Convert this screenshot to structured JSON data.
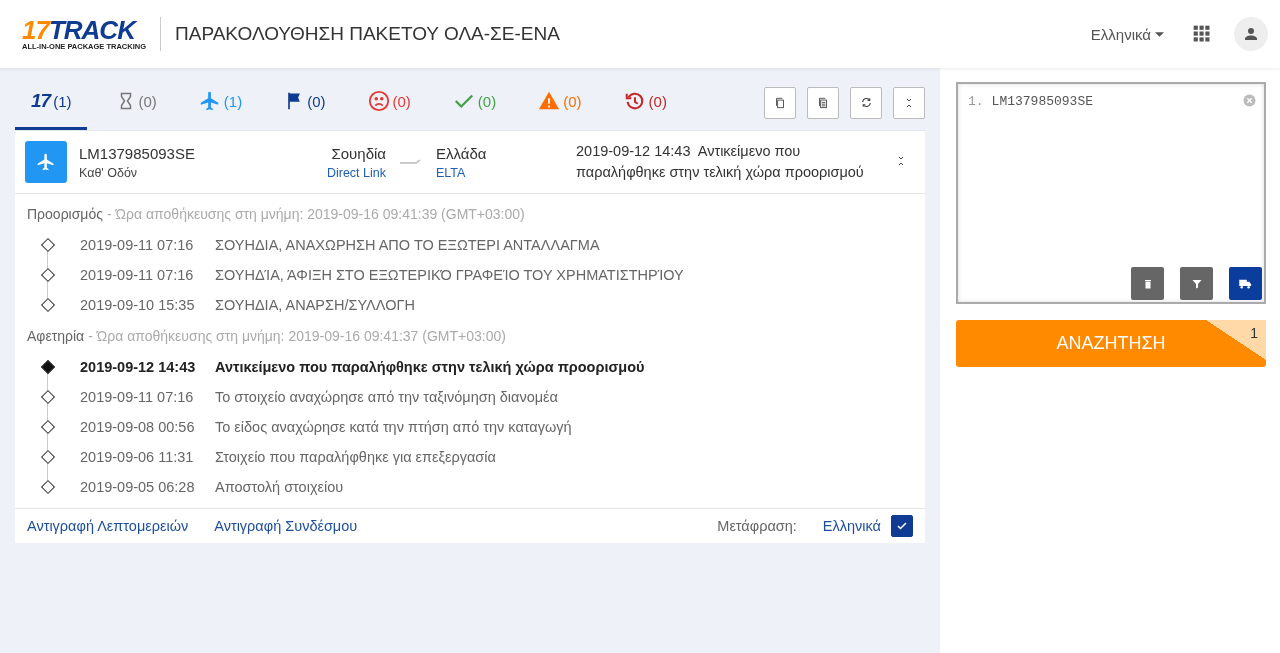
{
  "header": {
    "logo": {
      "number": "17",
      "word": "TRACK",
      "tagline": "ALL-IN-ONE PACKAGE TRACKING"
    },
    "title": "ΠΑΡΑΚΟΛΟΥΘΗΣΗ ΠΑΚΕΤΟΥ ΟΛΑ-ΣΕ-ΕΝΑ",
    "language": "Ελληνικά"
  },
  "tabs": [
    {
      "kind": "all",
      "glyph": "17",
      "count": "(1)",
      "selected": true
    },
    {
      "kind": "pending",
      "count": "(0)",
      "selected": false
    },
    {
      "kind": "transit",
      "count": "(1)",
      "selected": false
    },
    {
      "kind": "pickup",
      "count": "(0)",
      "selected": false
    },
    {
      "kind": "undelivered",
      "count": "(0)",
      "selected": false
    },
    {
      "kind": "delivered",
      "count": "(0)",
      "selected": false
    },
    {
      "kind": "alert",
      "count": "(0)",
      "selected": false
    },
    {
      "kind": "expired",
      "count": "(0)",
      "selected": false
    }
  ],
  "package": {
    "number": "LM137985093SE",
    "status": "Καθ' Οδόν",
    "origin": "Σουηδία",
    "origin_carrier": "Direct Link",
    "destination": "Ελλάδα",
    "destination_carrier": "ELTA",
    "latest_time": "2019-09-12 14:43",
    "latest_event": "Αντικείμενο που παραλήφθηκε στην τελική χώρα προορισμού"
  },
  "sections": [
    {
      "label": "Προορισμός",
      "stored": "- Ώρα αποθήκευσης στη μνήμη: 2019-09-16 09:41:39 (GMT+03:00)",
      "events": [
        {
          "time": "2019-09-11 07:16",
          "text": "ΣΟΥΗΔΙΑ, ΑΝΑΧΩΡΗΣΗ ΑΠΟ ΤΟ ΕΞΩΤΕΡΙ ΑΝΤΑΛΛΑΓΜΑ",
          "latest": false
        },
        {
          "time": "2019-09-11 07:16",
          "text": "ΣΟΥΗΔΊΑ, ΆΦΙΞΗ ΣΤΟ ΕΞΩΤΕΡΙΚΌ ΓΡΑΦΕΊΟ ΤΟΥ ΧΡΗΜΑΤΙΣΤΗΡΊΟΥ",
          "latest": false
        },
        {
          "time": "2019-09-10 15:35",
          "text": "ΣΟΥΗΔΙΑ, ΑΝΑΡΣΗ/ΣΥΛΛΟΓΗ",
          "latest": false
        }
      ]
    },
    {
      "label": "Αφετηρία",
      "stored": "- Ώρα αποθήκευσης στη μνήμη: 2019-09-16 09:41:37 (GMT+03:00)",
      "events": [
        {
          "time": "2019-09-12 14:43",
          "text": "Αντικείμενο που παραλήφθηκε στην τελική χώρα προορισμού",
          "latest": true
        },
        {
          "time": "2019-09-11 07:16",
          "text": "Το στοιχείο αναχώρησε από την ταξινόμηση διανομέα",
          "latest": false
        },
        {
          "time": "2019-09-08 00:56",
          "text": "Το είδος αναχώρησε κατά την πτήση από την καταγωγή",
          "latest": false
        },
        {
          "time": "2019-09-06 11:31",
          "text": "Στοιχείο που παραλήφθηκε για επεξεργασία",
          "latest": false
        },
        {
          "time": "2019-09-05 06:28",
          "text": "Αποστολή στοιχείου",
          "latest": false
        }
      ]
    }
  ],
  "footer": {
    "links": [
      "Αντιγραφή Λεπτομερειών",
      "Αντιγραφή Συνδέσμου"
    ],
    "translate_label": "Μετάφραση:",
    "translate_language": "Ελληνικά",
    "translate_checked": true
  },
  "search": {
    "line_number": "1.",
    "value": "LM137985093SE",
    "button": "ΑΝΑΖΗΤΗΣΗ",
    "badge": "1"
  }
}
